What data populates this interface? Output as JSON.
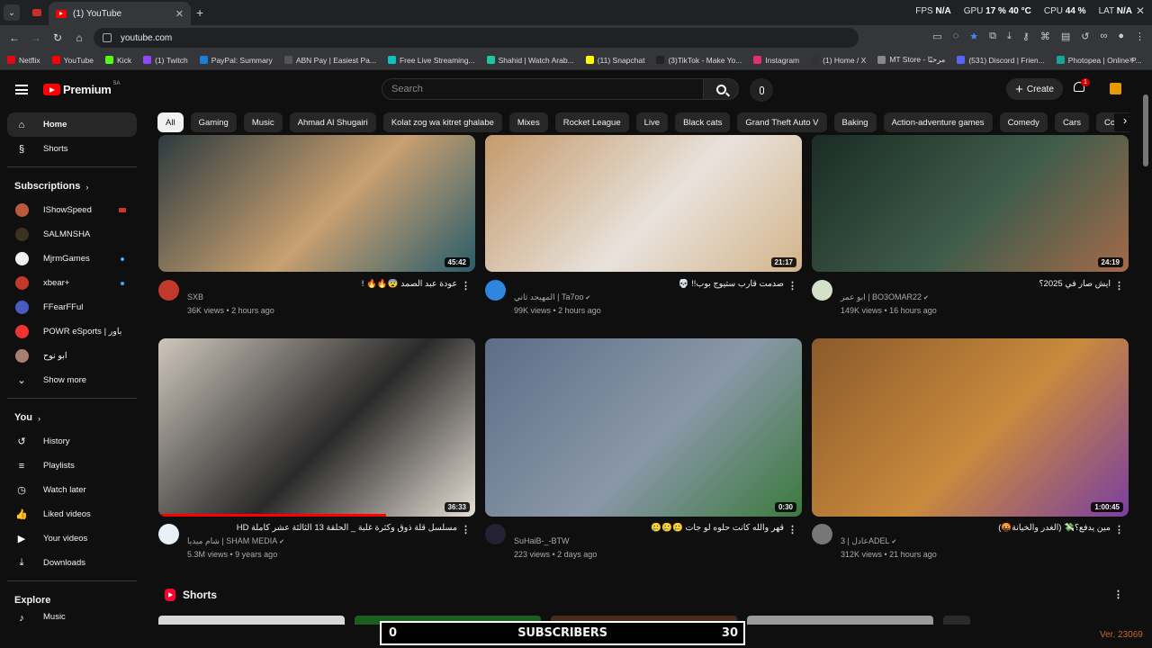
{
  "browser": {
    "tabs": [
      {
        "title": "(1) YouTube",
        "active": true
      }
    ],
    "url": "youtube.com",
    "perf": {
      "fps_label": "FPS",
      "fps": "N/A",
      "gpu_label": "GPU",
      "gpu": "17 % 40 °C",
      "cpu_label": "CPU",
      "cpu": "44 %",
      "lat_label": "LAT",
      "lat": "N/A"
    },
    "bookmarks": [
      {
        "label": "Netflix",
        "color": "#e50914"
      },
      {
        "label": "YouTube",
        "color": "#ff0000"
      },
      {
        "label": "Kick",
        "color": "#53fc18"
      },
      {
        "label": "(1) Twitch",
        "color": "#9146ff"
      },
      {
        "label": "PayPal: Summary",
        "color": "#1b7fd8"
      },
      {
        "label": "ABN Pay | Easiest Pa...",
        "color": "#555"
      },
      {
        "label": "Free Live Streaming...",
        "color": "#10c0c0"
      },
      {
        "label": "Shahid | Watch Arab...",
        "color": "#1cc7a0"
      },
      {
        "label": "(11) Snapchat",
        "color": "#fffc00"
      },
      {
        "label": "(3)TikTok - Make Yo...",
        "color": "#222"
      },
      {
        "label": "Instagram",
        "color": "#e1306c"
      },
      {
        "label": "(1) Home / X",
        "color": "#333"
      },
      {
        "label": "MT Store - مرحبًا",
        "color": "#888"
      },
      {
        "label": "(531) Discord | Frien...",
        "color": "#5865f2"
      },
      {
        "label": "Photopea | Online P...",
        "color": "#18a497"
      }
    ]
  },
  "masthead": {
    "logo": "Premium",
    "region": "SA",
    "search_placeholder": "Search",
    "create_label": "Create",
    "notifications": "1"
  },
  "sidebar": {
    "main": [
      {
        "label": "Home",
        "icon": "home-icon",
        "glyph": "⌂"
      },
      {
        "label": "Shorts",
        "icon": "shorts-icon",
        "glyph": "§"
      }
    ],
    "subscriptions_label": "Subscriptions",
    "subscriptions": [
      {
        "label": "IShowSpeed",
        "color": "#b85a3b",
        "live": "flag"
      },
      {
        "label": "SALMNSHA",
        "color": "#3a3320",
        "live": ""
      },
      {
        "label": "MjrmGames",
        "color": "#f1f1f1",
        "live": "dot"
      },
      {
        "label": "xbear+",
        "color": "#c0392b",
        "live": "dot"
      },
      {
        "label": "FFearFFul",
        "color": "#4a5bbf",
        "live": ""
      },
      {
        "label": "POWR eSports | باور",
        "color": "#e33",
        "live": ""
      },
      {
        "label": "ابو نوح",
        "color": "#a88070",
        "live": ""
      }
    ],
    "show_more": "Show more",
    "you_label": "You",
    "you": [
      {
        "label": "History",
        "icon": "history-icon",
        "glyph": "↺"
      },
      {
        "label": "Playlists",
        "icon": "playlists-icon",
        "glyph": "≡"
      },
      {
        "label": "Watch later",
        "icon": "watch-later-icon",
        "glyph": "◷"
      },
      {
        "label": "Liked videos",
        "icon": "like-icon",
        "glyph": "👍"
      },
      {
        "label": "Your videos",
        "icon": "your-videos-icon",
        "glyph": "▶"
      },
      {
        "label": "Downloads",
        "icon": "download-icon",
        "glyph": "⤓"
      }
    ],
    "explore_label": "Explore",
    "explore_partial": "Music"
  },
  "chips": [
    "All",
    "Gaming",
    "Music",
    "Ahmad Al Shugairi",
    "Kolat zog wa kitret ghalabe",
    "Mixes",
    "Rocket League",
    "Live",
    "Black cats",
    "Grand Theft Auto V",
    "Baking",
    "Action-adventure games",
    "Comedy",
    "Cars",
    "Consumer Electronics"
  ],
  "videos": [
    {
      "title": "عودة عبد الصمد 😨🔥🔥 !",
      "channel": "SXB",
      "verified": false,
      "stats": "36K views • 2 hours ago",
      "duration": "45:42",
      "colors": [
        "#2d3b3f",
        "#c9a070",
        "#2a5c6a"
      ],
      "avatar": "#c0392b"
    },
    {
      "title": "صدمت قارب ستيوج بوب!! 💀",
      "channel": "المهيجد ثاني | Ta7oo",
      "verified": true,
      "stats": "99K views • 2 hours ago",
      "duration": "21:17",
      "colors": [
        "#c49a6a",
        "#e8e2dc",
        "#d3b48a"
      ],
      "avatar": "#2e86de"
    },
    {
      "title": "ايش صار في 2025؟",
      "channel": "ابو عمر | BO3OMAR22",
      "verified": true,
      "stats": "149K views • 16 hours ago",
      "duration": "24:19",
      "colors": [
        "#1a2c25",
        "#3f5c4a",
        "#a36a4a"
      ],
      "avatar": "#d4e0c8"
    },
    {
      "title": "مسلسل قلة ذوق وكثرة غلبة _ الحلقة 13 الثالثة عشر كاملة HD",
      "channel": "شام ميديا | SHAM MEDIA",
      "verified": true,
      "stats": "5.3M views • 9 years ago",
      "duration": "36:33",
      "colors": [
        "#cfc7bd",
        "#2a2a2a",
        "#e6ded4"
      ],
      "avatar": "#e8f0f8",
      "progress": 0.72
    },
    {
      "title": "قهر والله كانت حلوه لو جات 🥲🥲🥲",
      "channel": "SuHaiB-_-BTW",
      "verified": false,
      "stats": "223 views • 2 days ago",
      "duration": "0:30",
      "colors": [
        "#5c6d86",
        "#8a97a8",
        "#3b7a3e"
      ],
      "avatar": "#223"
    },
    {
      "title": "مين يدفع؟💸 (الغدر والخيانة🤬)",
      "channel": "عادل | 3ADEL",
      "verified": true,
      "stats": "312K views • 21 hours ago",
      "duration": "1:00:45",
      "colors": [
        "#8b5a2b",
        "#c98a3c",
        "#7b3fa0"
      ],
      "avatar": "#777"
    }
  ],
  "shorts": {
    "title": "Shorts",
    "colors": [
      "#d8d8d8",
      "#1b5e20",
      "#4a2a1a",
      "#9a9a9a",
      "#2a2a2a"
    ]
  },
  "overlay": {
    "left_count": "0",
    "label": "SUBSCRIBERS",
    "right_count": "30",
    "version": "Ver. 23069"
  }
}
